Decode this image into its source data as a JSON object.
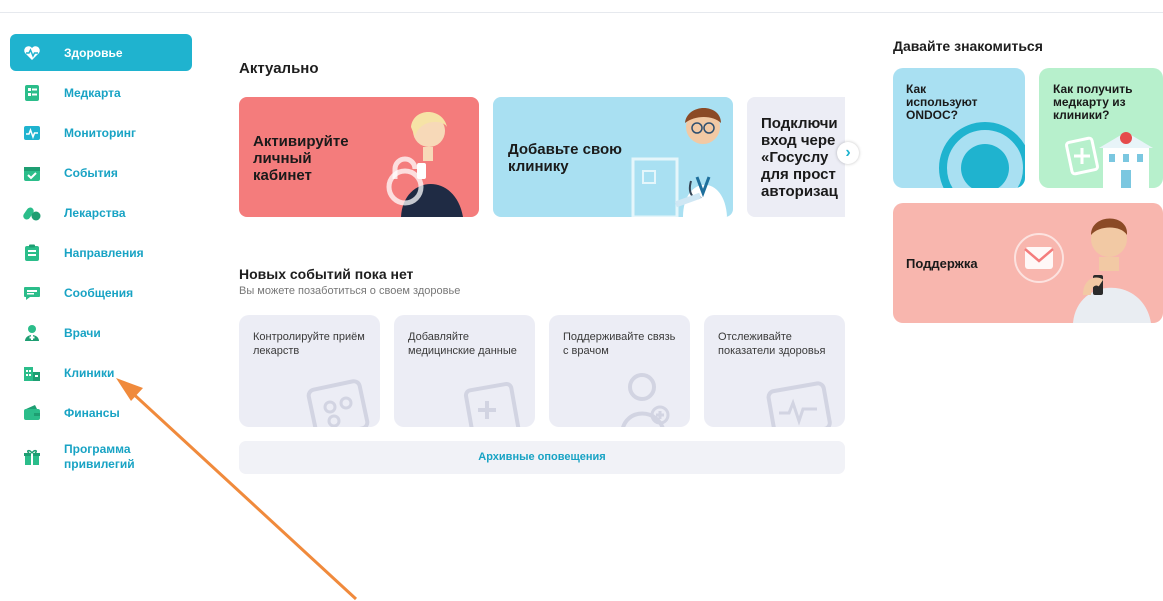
{
  "sidebar": {
    "items": [
      {
        "label": "Здоровье",
        "icon": "heart-icon",
        "active": true
      },
      {
        "label": "Медкарта",
        "icon": "medcard-icon"
      },
      {
        "label": "Мониторинг",
        "icon": "monitoring-icon"
      },
      {
        "label": "События",
        "icon": "calendar-icon"
      },
      {
        "label": "Лекарства",
        "icon": "pills-icon"
      },
      {
        "label": "Направления",
        "icon": "clipboard-icon"
      },
      {
        "label": "Сообщения",
        "icon": "chat-icon"
      },
      {
        "label": "Врачи",
        "icon": "doctor-icon"
      },
      {
        "label": "Клиники",
        "icon": "clinic-icon"
      },
      {
        "label": "Финансы",
        "icon": "wallet-icon"
      },
      {
        "label": "Программа привилегий",
        "icon": "gift-icon"
      }
    ]
  },
  "main": {
    "current_title": "Актуально",
    "banners": [
      {
        "text": "Активируйте\nличный\nкабинет",
        "color": "#f47c7c"
      },
      {
        "text": "Добавьте свою\nклинику",
        "color": "#a9e0f2"
      },
      {
        "text": "Подключи\nвход чере\n«Госуслу\nдля прост\nавторизац",
        "color": "#ecedf5"
      }
    ],
    "events_title": "Новых событий пока нет",
    "events_subtitle": "Вы можете позаботиться о своем здоровье",
    "tips": [
      {
        "text": "Контролируйте приём лекарств",
        "icon": "pills-book-icon"
      },
      {
        "text": "Добавляйте медицинские данные",
        "icon": "medcard-doc-icon"
      },
      {
        "text": "Поддерживайте связь с врачом",
        "icon": "doctor-outline-icon"
      },
      {
        "text": "Отслеживайте показатели здоровья",
        "icon": "chart-icon"
      }
    ],
    "archive_label": "Архивные оповещения"
  },
  "right": {
    "title": "Давайте знакомиться",
    "cards": [
      {
        "text": "Как\nиспользуют\nONDOC?",
        "color": "#a9e0f2"
      },
      {
        "text": "Как получить\nмедкарту из\nклиники?",
        "color": "#b7f0cc"
      }
    ],
    "support": {
      "text": "Поддержка",
      "color": "#f8b6ae"
    }
  },
  "colors": {
    "accent": "#1fb3cf",
    "annotation_arrow": "#f08a3c"
  }
}
